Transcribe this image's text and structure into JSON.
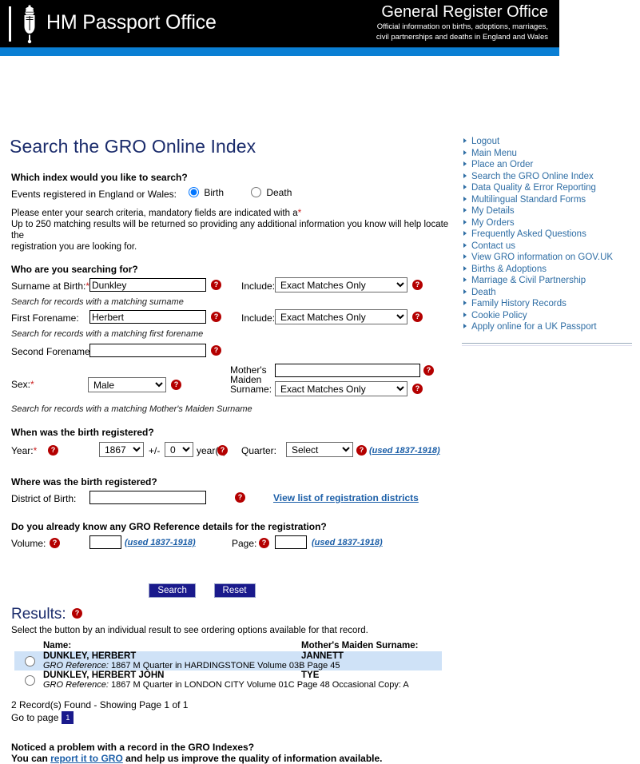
{
  "header": {
    "hmpo_title": "HM Passport Office",
    "gro_title": "General Register Office",
    "gro_sub_line1": "Official information on births, adoptions, marriages,",
    "gro_sub_line2": "civil partnerships and deaths in England and Wales",
    "crest_icon": "royal-crest-icon",
    "accent_blue": "#0a7fd4",
    "bg_black": "#000000"
  },
  "page_title": "Search the GRO Online Index",
  "index_section": {
    "heading": "Which index would you like to search?",
    "events_label": "Events registered in England or Wales:",
    "birth_label": "Birth",
    "death_label": "Death",
    "selected": "Birth",
    "note_line1_a": "Please enter your search criteria, mandatory fields are indicated with a",
    "note_line1_star": "*",
    "note_line2": "Up to 250 matching results will be returned so providing any additional information you know will help locate the",
    "note_line3": "registration you are looking for."
  },
  "who_section": {
    "heading": "Who are you searching for?",
    "surname_label": "Surname at Birth:",
    "surname_value": "Dunkley",
    "surname_include_label": "Include:",
    "surname_include_value": "Exact Matches Only",
    "surname_hint": "Search for records with a matching surname",
    "first_forename_label": "First Forename:",
    "first_forename_value": "Herbert",
    "first_include_label": "Include:",
    "first_include_value": "Exact Matches Only",
    "first_forename_hint": "Search for records with a matching first forename",
    "second_forename_label": "Second Forename:",
    "second_forename_value": "",
    "sex_label": "Sex:",
    "sex_value": "Male",
    "mother_label_line1": "Mother's",
    "mother_label_line2": "Maiden",
    "mother_label_line3": "Surname:",
    "mother_value": "",
    "mother_include_value": "Exact Matches Only",
    "mother_hint": "Search for records with a matching Mother's Maiden Surname"
  },
  "when_section": {
    "heading": "When was the birth registered?",
    "year_label": "Year:",
    "year_value": "1867",
    "plusminus_label": "+/-",
    "range_value": "0",
    "years_label": "year(s)",
    "quarter_label": "Quarter:",
    "quarter_value": "Select",
    "quarter_used": "(used 1837-1918)"
  },
  "where_section": {
    "heading": "Where was the birth registered?",
    "district_label": "District of Birth:",
    "district_value": "",
    "districts_link": "View list of registration districts"
  },
  "reference_section": {
    "heading": "Do you already know any GRO Reference details for the registration?",
    "volume_label": "Volume:",
    "volume_value": "",
    "volume_used": "(used 1837-1918)",
    "page_label": "Page:",
    "page_value": "",
    "page_used": "(used 1837-1918)"
  },
  "actions": {
    "search_label": "Search",
    "reset_label": "Reset"
  },
  "results": {
    "title": "Results:",
    "instruction": "Select the button by an individual result to see ordering options available for that record.",
    "col_name": "Name:",
    "col_mmn": "Mother's Maiden Surname:",
    "rows": [
      {
        "name": "DUNKLEY, HERBERT",
        "mmn": "JANNETT",
        "ref_label": "GRO Reference:",
        "ref_detail": "1867  M Quarter in HARDINGSTONE   Volume 03B  Page 45",
        "selected": false,
        "highlighted": true
      },
      {
        "name": "DUNKLEY, HERBERT  JOHN",
        "mmn": "TYE",
        "ref_label": "GRO Reference:",
        "ref_detail": "1867  M Quarter in LONDON CITY   Volume 01C  Page 48  Occasional Copy: A",
        "selected": false,
        "highlighted": false
      }
    ],
    "count_text": "2 Record(s) Found - Showing Page 1 of 1",
    "goto_label": "Go to page",
    "current_page": "1"
  },
  "footer": {
    "line1": "Noticed a problem with a record in the GRO Indexes?",
    "line2_pre": "You can ",
    "line2_link": "report it to GRO",
    "line2_post": " and help us improve the quality of information available."
  },
  "sidebar": {
    "items": [
      {
        "label": "Logout"
      },
      {
        "label": "Main Menu"
      },
      {
        "label": "Place an Order"
      },
      {
        "label": "Search the GRO Online Index"
      },
      {
        "label": "Data Quality & Error Reporting"
      },
      {
        "label": "Multilingual Standard Forms"
      },
      {
        "label": "My Details"
      },
      {
        "label": "My Orders"
      },
      {
        "label": "Frequently Asked Questions"
      },
      {
        "label": "Contact us"
      },
      {
        "label": "View GRO information on GOV.UK"
      },
      {
        "label": "Births & Adoptions"
      },
      {
        "label": "Marriage & Civil Partnership"
      },
      {
        "label": "Death"
      },
      {
        "label": "Family History Records"
      },
      {
        "label": "Cookie Policy"
      },
      {
        "label": "Apply online for a UK Passport"
      }
    ]
  },
  "help_icon_glyph": "?"
}
